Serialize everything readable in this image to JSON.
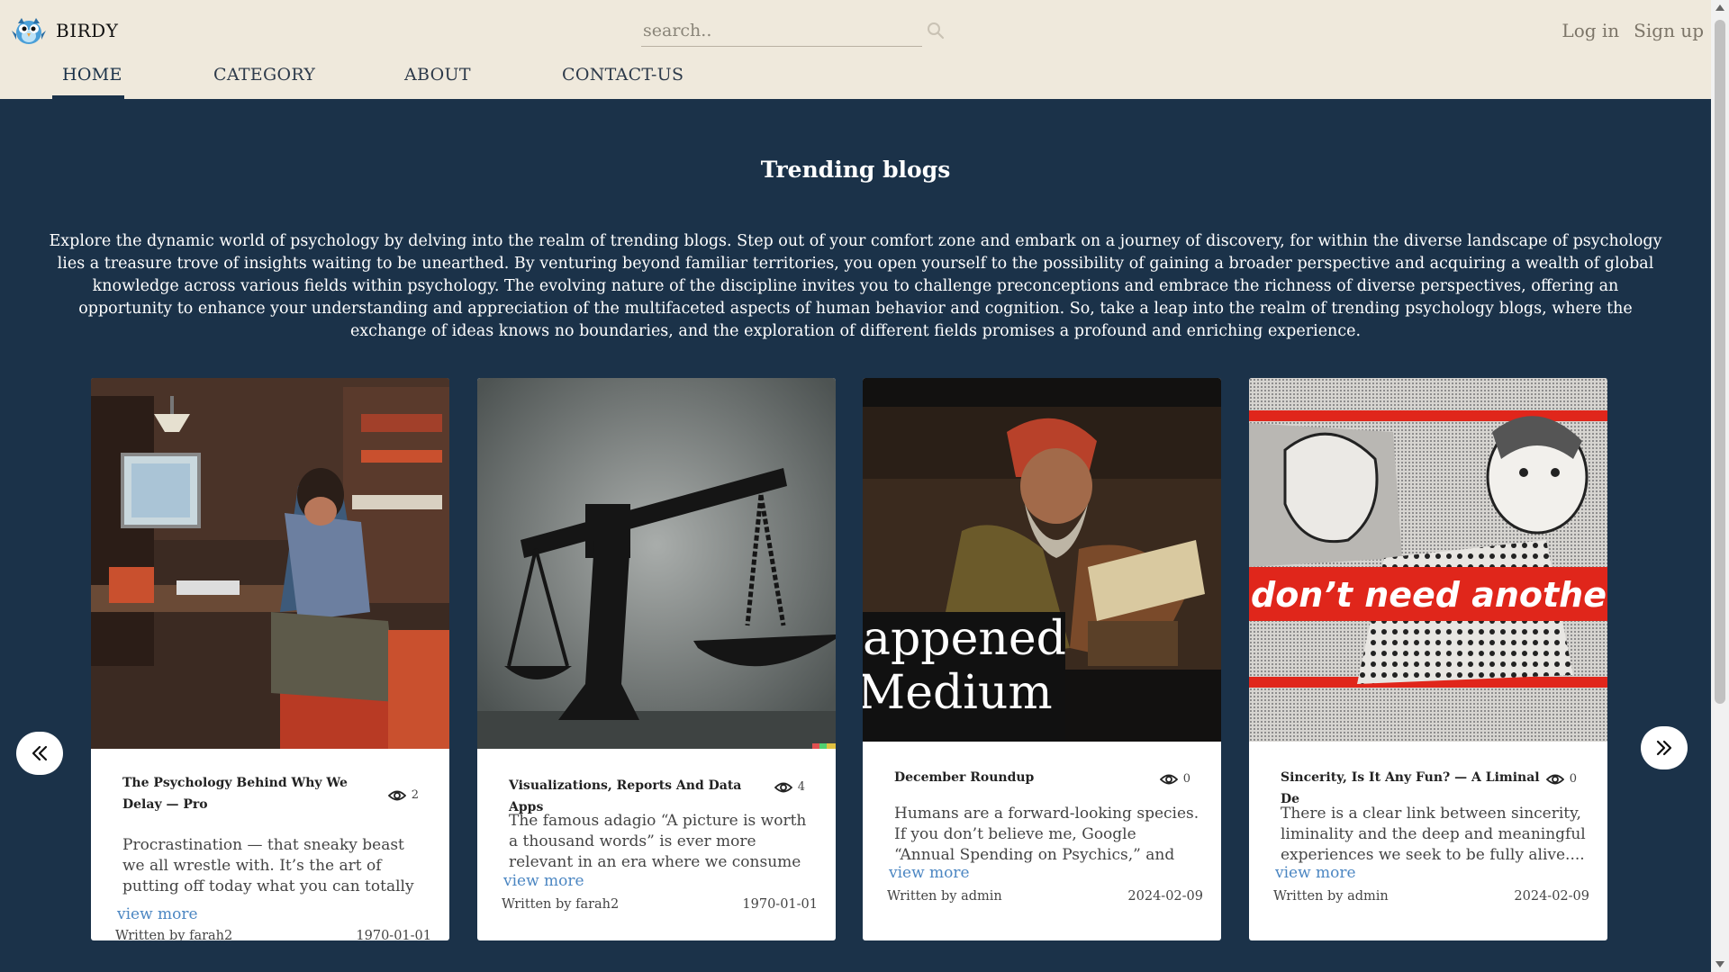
{
  "header": {
    "brand": "BIRDY",
    "search_placeholder": "search..",
    "login": "Log in",
    "signup": "Sign up",
    "nav": [
      "HOME",
      "CATEGORY",
      "ABOUT",
      "CONTACT-US"
    ],
    "active_nav": "HOME"
  },
  "main": {
    "title": "Trending blogs",
    "intro": "Explore the dynamic world of psychology by delving into the realm of trending blogs. Step out of your comfort zone and embark on a journey of discovery, for within the diverse landscape of psychology lies a treasure trove of insights waiting to be unearthed. By venturing beyond familiar territories, you open yourself to the possibility of gaining a broader perspective and acquiring a wealth of global knowledge across various fields within psychology. The evolving nature of the discipline invites you to challenge preconceptions and embrace the richness of diverse perspectives, offering an opportunity to enhance your understanding and appreciation of the multifaceted aspects of human behavior and cognition. So, take a leap into the realm of trending psychology blogs, where the exchange of ideas knows no boundaries, and the exploration of different fields promises a profound and enriching experience."
  },
  "cards": [
    {
      "title": "The Psychology Behind Why We Delay — Pro",
      "views": "2",
      "excerpt": "Procrastination — that sneaky beast we all wrestle with. It’s the art of putting off today what you can totally do tomorro...",
      "view_more": "view more",
      "author": "Written by farah2",
      "date": "1970-01-01",
      "image": "man-typing-at-desk-illustration"
    },
    {
      "title": "Visualizations, Reports And Data Apps",
      "views": "4",
      "excerpt": "The famous adagio “A picture is worth a thousand words” is ever more relevant in an era where we consume vast...",
      "view_more": "view more",
      "author": "Written by farah2",
      "date": "1970-01-01",
      "image": "scale-silhouette"
    },
    {
      "title": "December Roundup",
      "views": "0",
      "excerpt": "Humans are a forward-looking species. If you don’t believe me, Google “Annual Spending on Psychics,” and you’ll...",
      "view_more": "view more",
      "author": "Written by admin",
      "date": "2024-02-09",
      "image_text_1": "appened",
      "image_text_2": "Medium",
      "image": "scholar-painting"
    },
    {
      "title": "Sincerity, Is It Any Fun? — A Liminal De",
      "views": "0",
      "excerpt": "There is a clear link between sincerity, liminality and the deep and meaningful experiences we seek to be fully alive....",
      "view_more": "view more",
      "author": "Written by admin",
      "date": "2024-02-09",
      "image_text": "don’t need another h",
      "image": "pop-art-halftone"
    }
  ],
  "colors": {
    "header_bg": "#efe9dc",
    "page_bg": "#1b3249",
    "link": "#4b86c2",
    "banner_red": "#e0261b"
  }
}
